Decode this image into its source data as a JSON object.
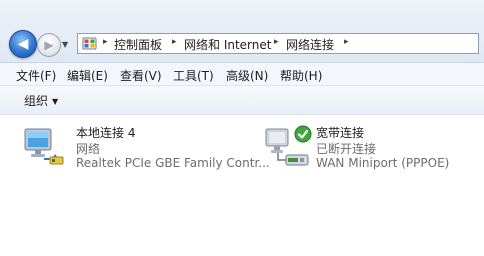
{
  "navigation": {
    "back_glyph": "◀",
    "forward_glyph": "▶",
    "recent_glyph": "▼"
  },
  "address": {
    "icon": "control-panel-icon",
    "separator": "▸",
    "crumbs": [
      "控制面板",
      "网络和 Internet",
      "网络连接"
    ]
  },
  "menu": {
    "items": [
      "文件(F)",
      "编辑(E)",
      "查看(V)",
      "工具(T)",
      "高级(N)",
      "帮助(H)"
    ]
  },
  "toolbar": {
    "organize_label": "组织",
    "organize_arrow": "▼"
  },
  "connections": [
    {
      "name": "本地连接 4",
      "status": "网络",
      "device": "Realtek PCIe GBE Family Contr...",
      "icon": "network-monitor-icon"
    },
    {
      "name": "宽带连接",
      "status": "已断开连接",
      "device": "WAN Miniport (PPPOE)",
      "icon": "broadband-modem-icon",
      "badge": "green-check-icon"
    }
  ],
  "colors": {
    "nav_button": "#2f76d4",
    "status_text": "#6d6d6d",
    "check_badge": "#3fa83c"
  }
}
